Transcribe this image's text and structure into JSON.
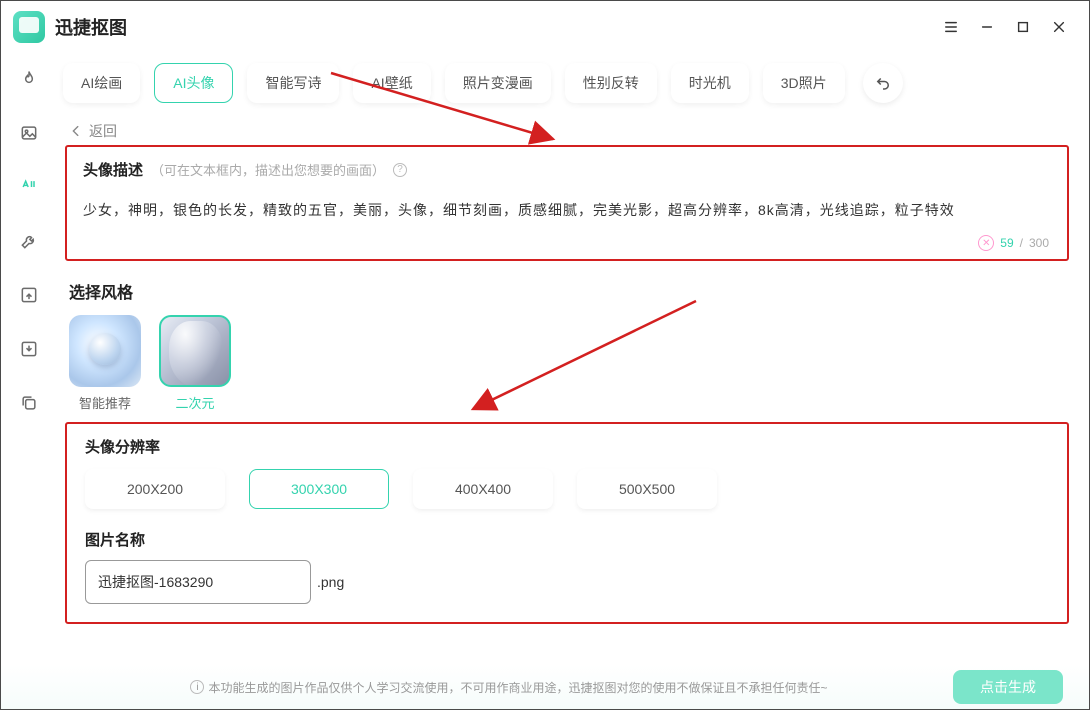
{
  "app": {
    "title": "迅捷抠图"
  },
  "tabs": [
    "AI绘画",
    "AI头像",
    "智能写诗",
    "AI壁纸",
    "照片变漫画",
    "性别反转",
    "时光机",
    "3D照片"
  ],
  "activeTab": 1,
  "back": "返回",
  "description": {
    "title": "头像描述",
    "hint": "（可在文本框内，描述出您想要的画面）",
    "text": "少女，神明，银色的长发，精致的五官，美丽，头像，细节刻画，质感细腻，完美光影，超高分辨率，8k高清，光线追踪，粒子特效",
    "count": "59",
    "max": "300"
  },
  "style": {
    "title": "选择风格",
    "items": [
      {
        "label": "智能推荐",
        "kind": "smart",
        "active": false
      },
      {
        "label": "二次元",
        "kind": "anime",
        "active": true
      }
    ]
  },
  "resolution": {
    "title": "头像分辨率",
    "options": [
      "200X200",
      "300X300",
      "400X400",
      "500X500"
    ],
    "active": 1
  },
  "filename": {
    "title": "图片名称",
    "value": "迅捷抠图-1683290",
    "ext": ".png"
  },
  "footer": {
    "disclaimer": "本功能生成的图片作品仅供个人学习交流使用，不可用作商业用途，迅捷抠图对您的使用不做保证且不承担任何责任~",
    "button": "点击生成"
  }
}
